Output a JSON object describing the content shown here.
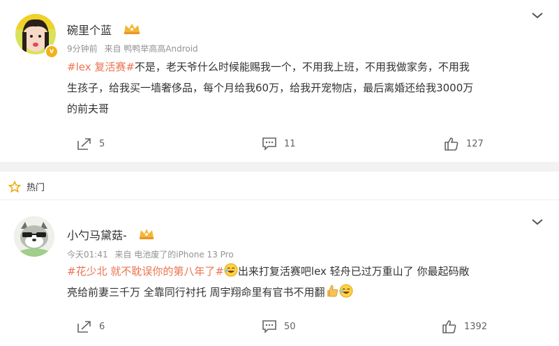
{
  "posts": [
    {
      "username": "碗里个蓝",
      "time": "9分钟前",
      "source": "来自 鸭鸭举高高Android",
      "topic": "#lex 复活赛#",
      "body_line1": "不是，老天爷什么时候能赐我一个，不用我上班，不用我做家务，不用我",
      "body_line2": "生孩子，给我买一墙奢侈品，每个月给我60万，给我开宠物店，最后离婚还给我3000万",
      "body_line3": "的前夫哥",
      "reposts": "5",
      "comments": "11",
      "likes": "127"
    },
    {
      "username": "小勺马黛菇-",
      "time": "今天01:41",
      "source": "来自 电池废了的iPhone 13 Pro",
      "topic": "#花少北 就不耽误你的第八年了#",
      "body_line1": "出来打复活赛吧lex 轻舟已过万重山了 你最起码敞",
      "body_line2": "亮给前妻三千万 全靠同行衬托 周宇翔命里有官书不用翻",
      "reposts": "6",
      "comments": "50",
      "likes": "1392"
    }
  ],
  "section": {
    "hot_label": "热门"
  },
  "icons": {
    "repost": "repost-icon",
    "comment": "comment-icon",
    "like": "thumbs-up-icon",
    "menu": "chevron-down-icon",
    "hot": "star-icon",
    "crown": "crown-badge-icon",
    "verified": "verified-badge-icon"
  },
  "colors": {
    "topic": "#eb7350",
    "meta": "#939393",
    "text": "#333333",
    "badge": "#f2b21a"
  }
}
